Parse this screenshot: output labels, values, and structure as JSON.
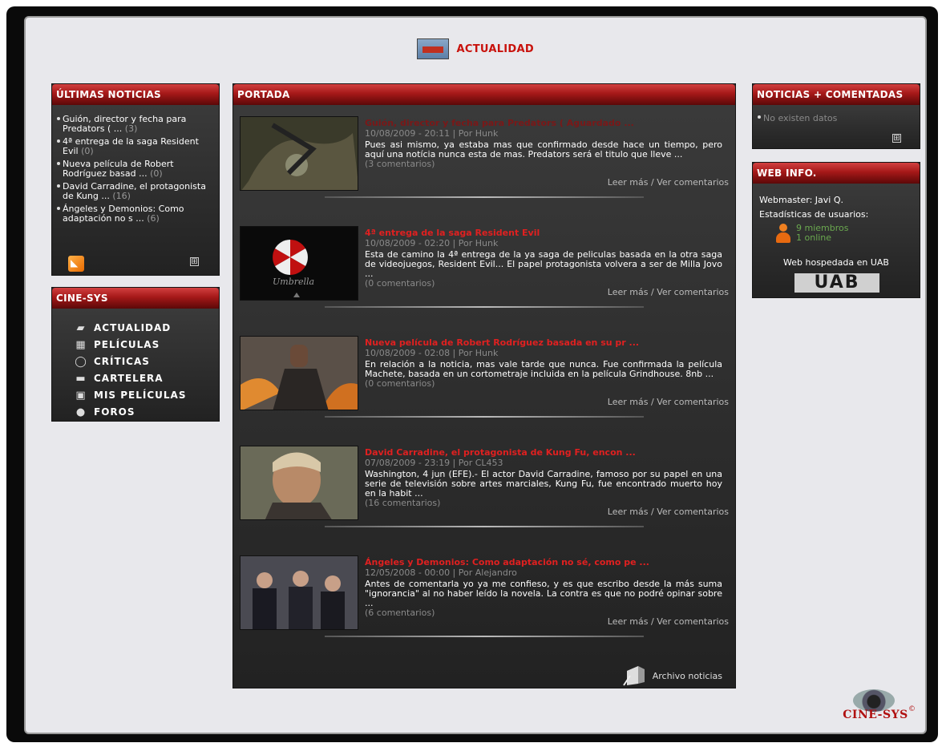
{
  "header": {
    "title": "ACTUALIDAD",
    "icon": "news-icon"
  },
  "ultimas": {
    "title": "ÚLTIMAS NOTICIAS",
    "items": [
      {
        "text": "Guión, director y fecha para Predators ( ...",
        "count": "(3)"
      },
      {
        "text": "4ª entrega de la saga Resident Evil",
        "count": "(0)"
      },
      {
        "text": "Nueva película de Robert Rodríguez basad ...",
        "count": "(0)"
      },
      {
        "text": "David Carradine, el protagonista de Kung ...",
        "count": "(16)"
      },
      {
        "text": "Ángeles y Demonios: Como adaptación no s ...",
        "count": "(6)"
      }
    ],
    "more": "⊞"
  },
  "cinesys": {
    "title": "CINE-SYS",
    "items": [
      {
        "label": "ACTUALIDAD",
        "icon": "▰"
      },
      {
        "label": "PELÍCULAS",
        "icon": "▦"
      },
      {
        "label": "CRÍTICAS",
        "icon": "◯"
      },
      {
        "label": "CARTELERA",
        "icon": "▬"
      },
      {
        "label": "MIS PELÍCULAS",
        "icon": "▣"
      },
      {
        "label": "FOROS",
        "icon": "●"
      }
    ]
  },
  "portada": {
    "title": "PORTADA",
    "articles": [
      {
        "title": "Guión, director y fecha para Predators ( Aguardado ...",
        "meta": "10/08/2009 - 20:11 | Por Hunk",
        "desc": "Pues asi mismo, ya estaba mas que confirmado desde hace un tiempo, pero aquí una notícia nunca esta de mas.   Predators será el titulo que lleve ...",
        "comments": "(3 comentarios)",
        "read_more": "Leer más",
        "sep": "/",
        "see_comments": "Ver comentarios"
      },
      {
        "title": "4ª entrega de la saga Resident Evil",
        "meta": "10/08/2009 - 02:20 | Por Hunk",
        "desc": "Esta de camino la 4ª entrega de la ya saga de peliculas basada en la otra saga de videojuegos, Resident Evil...   El papel protagonista volvera a ser de Milla Jovo ...",
        "comments": "(0 comentarios)",
        "read_more": "Leer más",
        "sep": "/",
        "see_comments": "Ver comentarios"
      },
      {
        "title": "Nueva película de Robert Rodríguez basada en su pr ...",
        "meta": "10/08/2009 - 02:08 | Por Hunk",
        "desc": "En relación a la noticia, mas vale tarde que nunca. Fue confirmada la película Machete, basada en un cortometraje incluida en la película Grindhouse. 8nb ...",
        "comments": "(0 comentarios)",
        "read_more": "Leer más",
        "sep": "/",
        "see_comments": "Ver comentarios"
      },
      {
        "title": "David Carradine, el protagonista de Kung Fu, encon ...",
        "meta": "07/08/2009 - 23:19 | Por CL453",
        "desc": "Washington, 4 jun (EFE).- El actor David Carradine, famoso por su papel en una serie de televisión sobre artes marciales, Kung Fu, fue encontrado muerto hoy en la habit ...",
        "comments": "(16 comentarios)",
        "read_more": "Leer más",
        "sep": "/",
        "see_comments": "Ver comentarios"
      },
      {
        "title": "Ángeles y Demonios: Como adaptación no sé, como pe ...",
        "meta": "12/05/2008 - 00:00 | Por Alejandro",
        "desc": "Antes de comentarla yo ya me confieso, y es que escribo desde la más suma \"ignorancia\" al no haber leído la novela. La contra es que no podré opinar sobre ...",
        "comments": "(6 comentarios)",
        "read_more": "Leer más",
        "sep": "/",
        "see_comments": "Ver comentarios"
      }
    ],
    "archive": "Archivo noticias"
  },
  "comentadas": {
    "title": "NOTICIAS + COMENTADAS",
    "nodata": "No existen datos",
    "more": "⊞"
  },
  "webinfo": {
    "title": "WEB INFO.",
    "webmaster": "Webmaster:  Javi Q.",
    "stats_label": "Estadísticas de usuarios:",
    "members": "9 miembros",
    "online": "1 online",
    "hosted": "Web hospedada en UAB",
    "uab": "UAB"
  },
  "logo": {
    "text": "CINE-SYS",
    "copy": "©"
  }
}
